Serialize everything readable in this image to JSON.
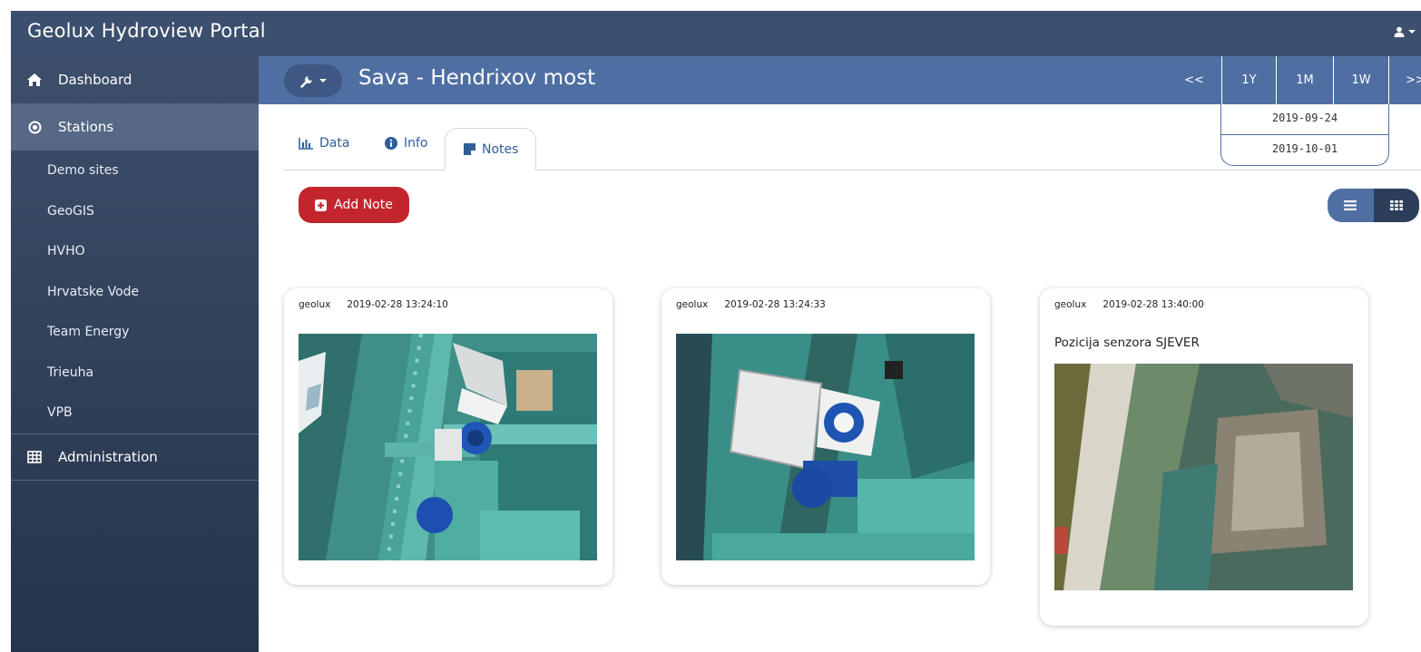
{
  "app": {
    "title": "Geolux Hydroview Portal"
  },
  "sidebar": {
    "dashboard_label": "Dashboard",
    "stations_label": "Stations",
    "station_groups": [
      "Demo sites",
      "GeoGIS",
      "HVHO",
      "Hrvatske Vode",
      "Team Energy",
      "Trieuha",
      "VPB"
    ],
    "administration_label": "Administration"
  },
  "station": {
    "title": "Sava - Hendrixov most",
    "range_buttons": [
      "<<",
      "1Y",
      "1M",
      "1W",
      ">>"
    ],
    "date_from": "2019-09-24",
    "date_to": "2019-10-01"
  },
  "tabs": {
    "data_label": "Data",
    "info_label": "Info",
    "notes_label": "Notes",
    "active": "Notes"
  },
  "notes_toolbar": {
    "add_note_label": "Add Note",
    "view_mode": "grid"
  },
  "notes": [
    {
      "user": "geolux",
      "timestamp": "2019-02-28 13:24:10",
      "text": ""
    },
    {
      "user": "geolux",
      "timestamp": "2019-02-28 13:24:33",
      "text": ""
    },
    {
      "user": "geolux",
      "timestamp": "2019-02-28 13:40:00",
      "text": "Pozicija senzora SJEVER"
    }
  ],
  "colors": {
    "header_bg": "#3c4f6e",
    "station_bar_bg": "#4f6fa3",
    "sidebar_active_bg": "#566885",
    "add_button": "#c2262c",
    "tab_text": "#2f5d98"
  },
  "icons": {
    "user": "user-icon",
    "dashboard": "home-icon",
    "stations": "dot-circle-icon",
    "administration": "table-icon",
    "wrench": "wrench-icon",
    "data_tab": "bar-chart-icon",
    "info_tab": "info-circle-icon",
    "notes_tab": "sticky-note-icon",
    "add_note": "plus-square-icon",
    "list_view": "list-icon",
    "grid_view": "grid-icon"
  }
}
